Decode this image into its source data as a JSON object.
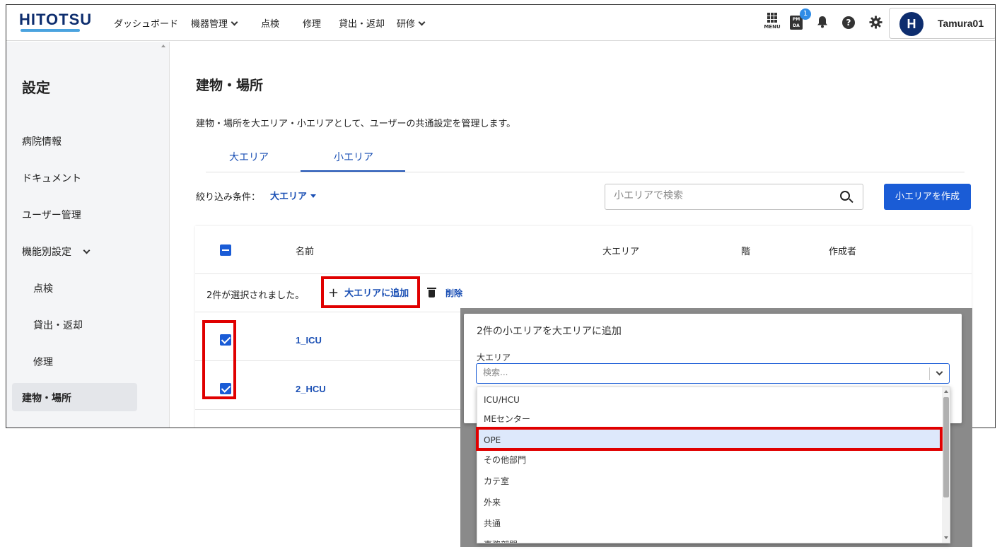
{
  "header": {
    "logo": "HITOTSU",
    "nav": [
      {
        "label": "ダッシュボード",
        "dropdown": false
      },
      {
        "label": "機器管理",
        "dropdown": true
      },
      {
        "label": "点検",
        "dropdown": false
      },
      {
        "label": "修理",
        "dropdown": false
      },
      {
        "label": "貸出・返却",
        "dropdown": false
      },
      {
        "label": "研修",
        "dropdown": true
      }
    ],
    "menu_label": "MENU",
    "pmda_label_top": "PM",
    "pmda_label_bottom": "DA",
    "notification_count": "1",
    "help_glyph": "?",
    "user": {
      "avatar_letter": "H",
      "name": "Tamura01"
    },
    "icons": [
      "grid-menu-icon",
      "pmda-icon",
      "bell-icon",
      "help-icon",
      "gear-icon"
    ]
  },
  "sidebar": {
    "title": "設定",
    "items": [
      {
        "label": "病院情報"
      },
      {
        "label": "ドキュメント"
      },
      {
        "label": "ユーザー管理"
      },
      {
        "label": "機能別設定"
      },
      {
        "label": "点検"
      },
      {
        "label": "貸出・返却"
      },
      {
        "label": "修理"
      },
      {
        "label": "建物・場所"
      }
    ]
  },
  "main": {
    "title": "建物・場所",
    "description": "建物・場所を大エリア・小エリアとして、ユーザーの共通設定を管理します。",
    "tabs": [
      {
        "label": "大エリア"
      },
      {
        "label": "小エリア"
      }
    ],
    "active_tab": "小エリア",
    "filter_label": "絞り込み条件：",
    "filter_value": "大エリア",
    "search_placeholder": "小エリアで検索",
    "create_button": "小エリアを作成",
    "table": {
      "columns": [
        "名前",
        "大エリア",
        "階",
        "作成者"
      ],
      "selection_text": "2件が選択されました。",
      "add_to_area_label": "大エリアに追加",
      "delete_label": "削除",
      "rows": [
        {
          "name": "1_ICU",
          "checked": true
        },
        {
          "name": "2_HCU",
          "checked": true
        }
      ]
    }
  },
  "dialog": {
    "title": "2件の小エリアを大エリアに追加",
    "field_label": "大エリア",
    "search_placeholder": "検索...",
    "options": [
      {
        "label": "ICU/HCU"
      },
      {
        "label": "MEセンター"
      },
      {
        "label": "OPE"
      },
      {
        "label": "その他部門"
      },
      {
        "label": "カテ室"
      },
      {
        "label": "外来"
      },
      {
        "label": "共通"
      },
      {
        "label": "事務部門"
      }
    ],
    "highlighted_option": "OPE"
  },
  "colors": {
    "brand": "#0d2d6e",
    "accent": "#1a5cd6",
    "link": "#1a4fb4",
    "annotation_red": "#e00000",
    "highlight": "#dde8fb"
  }
}
